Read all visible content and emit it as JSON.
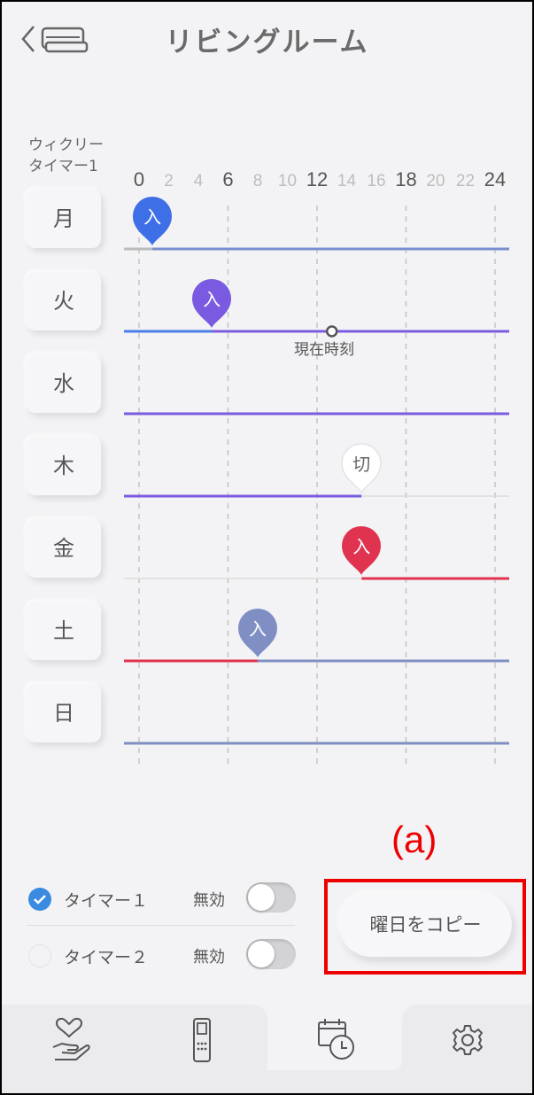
{
  "header": {
    "title": "リビングルーム",
    "back_icon": "chevron-left-icon",
    "device_icon": "air-conditioner-icon"
  },
  "schedule": {
    "label": "ウィクリー\nタイマー1",
    "hours": [
      {
        "text": "0",
        "major": true
      },
      {
        "text": "2",
        "major": false
      },
      {
        "text": "4",
        "major": false
      },
      {
        "text": "6",
        "major": true
      },
      {
        "text": "8",
        "major": false
      },
      {
        "text": "10",
        "major": false
      },
      {
        "text": "12",
        "major": true
      },
      {
        "text": "14",
        "major": false
      },
      {
        "text": "16",
        "major": false
      },
      {
        "text": "18",
        "major": true
      },
      {
        "text": "20",
        "major": false
      },
      {
        "text": "22",
        "major": false
      },
      {
        "text": "24",
        "major": true
      }
    ],
    "days": [
      {
        "label": "月"
      },
      {
        "label": "火"
      },
      {
        "label": "水"
      },
      {
        "label": "木"
      },
      {
        "label": "金"
      },
      {
        "label": "土"
      },
      {
        "label": "日"
      }
    ],
    "now_label": "現在時刻",
    "events": [
      {
        "day": 0,
        "hour": 0.9,
        "label": "入",
        "color": "#3f6fe6"
      },
      {
        "day": 1,
        "hour": 4.9,
        "label": "入",
        "color": "#7a5ae0"
      },
      {
        "day": 3,
        "hour": 15.0,
        "label": "切",
        "color": "#ffffff"
      },
      {
        "day": 4,
        "hour": 15.0,
        "label": "入",
        "color": "#e0334f"
      },
      {
        "day": 5,
        "hour": 8.0,
        "label": "入",
        "color": "#7f8fc4"
      }
    ]
  },
  "timers": [
    {
      "name": "タイマー１",
      "state": "無効",
      "checked": true
    },
    {
      "name": "タイマー２",
      "state": "無効",
      "checked": false
    }
  ],
  "copy_button": "曜日をコピー",
  "annotation": "(a)",
  "nav": {
    "items": [
      "home-care-icon",
      "remote-icon",
      "timer-calendar-icon",
      "settings-gear-icon"
    ]
  },
  "colors": {
    "blue": "#4a7de8",
    "purple": "#7b5be0",
    "red": "#e0334f",
    "annotation": "#ee0000"
  }
}
